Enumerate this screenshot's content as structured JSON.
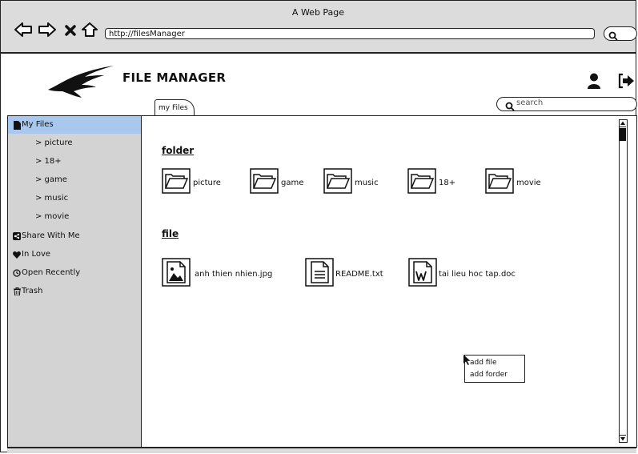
{
  "window": {
    "title": "A Web Page"
  },
  "browser": {
    "url": "http://filesManager",
    "nav_icons": [
      "arrow-left-icon",
      "arrow-right-icon",
      "close-x-icon",
      "home-icon"
    ],
    "search_icon": "search-icon"
  },
  "header": {
    "title": "FILE MANAGER",
    "logo": "bird-logo",
    "user_icon": "user-icon",
    "logout_icon": "logout-icon"
  },
  "tab": {
    "label": "my Files"
  },
  "search": {
    "placeholder": "search"
  },
  "sidebar": {
    "items": [
      {
        "label": "My Files",
        "icon": "file-icon",
        "active": true
      },
      {
        "label": "> picture",
        "sub": true
      },
      {
        "label": "> 18+",
        "sub": true
      },
      {
        "label": "> game",
        "sub": true
      },
      {
        "label": "> music",
        "sub": true
      },
      {
        "label": "> movie",
        "sub": true
      },
      {
        "label": "Share With Me",
        "icon": "share-icon"
      },
      {
        "label": "In Love",
        "icon": "heart-icon"
      },
      {
        "label": "Open Recently",
        "icon": "clock-icon"
      },
      {
        "label": "Trash",
        "icon": "trash-icon"
      }
    ]
  },
  "main": {
    "folder_title": "folder",
    "folders": [
      {
        "name": "picture"
      },
      {
        "name": "game"
      },
      {
        "name": "music"
      },
      {
        "name": "18+"
      },
      {
        "name": "movie"
      }
    ],
    "file_title": "file",
    "files": [
      {
        "name": "anh thien nhien.jpg",
        "icon": "image-file-icon"
      },
      {
        "name": "README.txt",
        "icon": "text-file-icon"
      },
      {
        "name": "tai lieu hoc tap.doc",
        "icon": "word-file-icon"
      }
    ]
  },
  "context_menu": {
    "items": [
      {
        "label": "add file"
      },
      {
        "label": "add forder"
      }
    ]
  },
  "colors": {
    "chrome": "#dcdcdc",
    "sidebar": "#d3d3d3",
    "active": "#a9c8ee",
    "outline": "#222222"
  }
}
